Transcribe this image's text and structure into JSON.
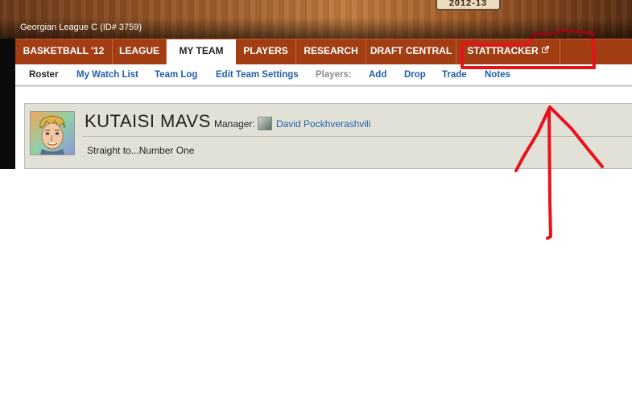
{
  "banner": {
    "season": "2012-13",
    "league": "Georgian League C (ID# 3759)"
  },
  "nav": {
    "tabs": [
      {
        "label": "BASKETBALL '12"
      },
      {
        "label": "LEAGUE"
      },
      {
        "label": "MY TEAM",
        "active": true
      },
      {
        "label": "PLAYERS"
      },
      {
        "label": "RESEARCH"
      },
      {
        "label": "DRAFT CENTRAL"
      },
      {
        "label": "STATTRACKER",
        "icon": "external-link-icon"
      }
    ]
  },
  "subnav": {
    "roster": "Roster",
    "watch_list": "My Watch List",
    "team_log": "Team Log",
    "edit_settings": "Edit Team Settings",
    "players_label": "Players:",
    "add": "Add",
    "drop": "Drop",
    "trade": "Trade",
    "notes": "Notes"
  },
  "team": {
    "name": "KUTAISI MAVS",
    "manager_label": "Manager:",
    "manager_name": "David Pockhverashvili",
    "tagline": "Straight to...Number One"
  },
  "colors": {
    "nav_bg": "#a23d14",
    "link": "#1f5fa8",
    "annotation": "#e8121c",
    "panel_bg": "#e2e1d7"
  }
}
